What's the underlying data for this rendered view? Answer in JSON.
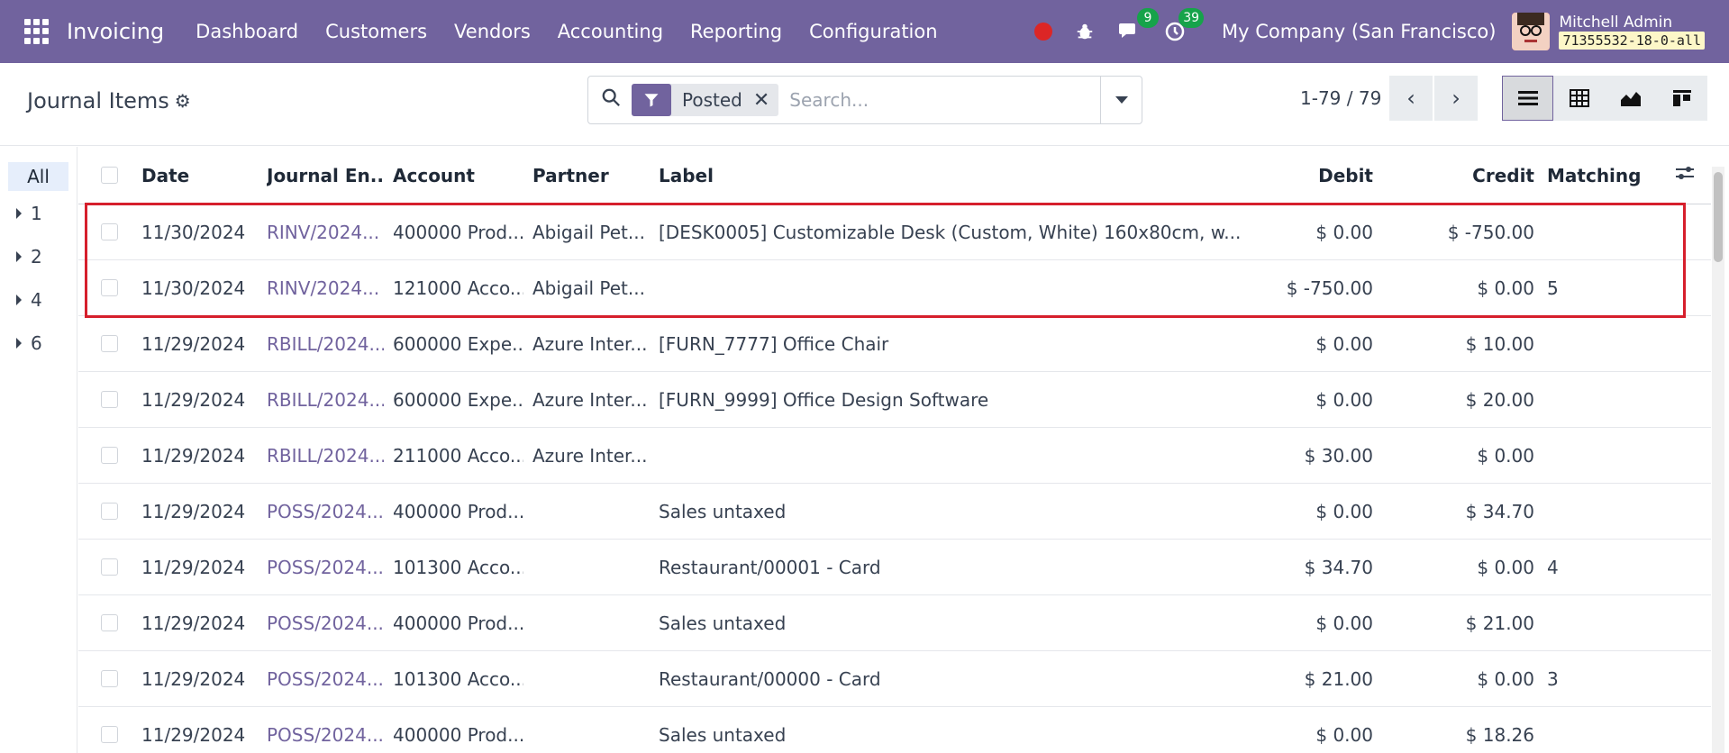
{
  "nav": {
    "brand": "Invoicing",
    "menu": [
      "Dashboard",
      "Customers",
      "Vendors",
      "Accounting",
      "Reporting",
      "Configuration"
    ],
    "messages_count": "9",
    "activities_count": "39",
    "company": "My Company (San Francisco)",
    "user_name": "Mitchell Admin",
    "db_label": "71355532-18-0-all"
  },
  "control": {
    "title": "Journal Items",
    "facet_label": "Posted",
    "search_placeholder": "Search...",
    "pager": "1-79 / 79"
  },
  "side": {
    "all_label": "All",
    "groups": [
      "1",
      "2",
      "4",
      "6"
    ]
  },
  "table": {
    "headers": {
      "date": "Date",
      "journal_entry": "Journal En...",
      "account": "Account",
      "partner": "Partner",
      "label": "Label",
      "debit": "Debit",
      "credit": "Credit",
      "matching": "Matching"
    },
    "rows": [
      {
        "date": "11/30/2024",
        "je": "RINV/2024...",
        "account": "400000 Prod...",
        "partner": "Abigail Pet...",
        "label": "[DESK0005] Customizable Desk (Custom, White) 160x80cm, w...",
        "debit": "$ 0.00",
        "credit": "$ -750.00",
        "matching": ""
      },
      {
        "date": "11/30/2024",
        "je": "RINV/2024...",
        "account": "121000 Acco...",
        "partner": "Abigail Pet...",
        "label": "",
        "debit": "$ -750.00",
        "credit": "$ 0.00",
        "matching": "5"
      },
      {
        "date": "11/29/2024",
        "je": "RBILL/2024...",
        "account": "600000 Expe...",
        "partner": "Azure Inter...",
        "label": "[FURN_7777] Office Chair",
        "debit": "$ 0.00",
        "credit": "$ 10.00",
        "matching": ""
      },
      {
        "date": "11/29/2024",
        "je": "RBILL/2024...",
        "account": "600000 Expe...",
        "partner": "Azure Inter...",
        "label": "[FURN_9999] Office Design Software",
        "debit": "$ 0.00",
        "credit": "$ 20.00",
        "matching": ""
      },
      {
        "date": "11/29/2024",
        "je": "RBILL/2024...",
        "account": "211000 Acco...",
        "partner": "Azure Inter...",
        "label": "",
        "debit": "$ 30.00",
        "credit": "$ 0.00",
        "matching": ""
      },
      {
        "date": "11/29/2024",
        "je": "POSS/2024...",
        "account": "400000 Prod...",
        "partner": "",
        "label": "Sales untaxed",
        "debit": "$ 0.00",
        "credit": "$ 34.70",
        "matching": ""
      },
      {
        "date": "11/29/2024",
        "je": "POSS/2024...",
        "account": "101300 Acco...",
        "partner": "",
        "label": "Restaurant/00001 - Card",
        "debit": "$ 34.70",
        "credit": "$ 0.00",
        "matching": "4"
      },
      {
        "date": "11/29/2024",
        "je": "POSS/2024...",
        "account": "400000 Prod...",
        "partner": "",
        "label": "Sales untaxed",
        "debit": "$ 0.00",
        "credit": "$ 21.00",
        "matching": ""
      },
      {
        "date": "11/29/2024",
        "je": "POSS/2024...",
        "account": "101300 Acco...",
        "partner": "",
        "label": "Restaurant/00000 - Card",
        "debit": "$ 21.00",
        "credit": "$ 0.00",
        "matching": "3"
      },
      {
        "date": "11/29/2024",
        "je": "POSS/2024...",
        "account": "400000 Prod...",
        "partner": "",
        "label": "Sales untaxed",
        "debit": "$ 0.00",
        "credit": "$ 18.26",
        "matching": ""
      }
    ]
  },
  "colors": {
    "brand": "#71639e",
    "badge": "#16a34a",
    "highlight": "#d61f2c"
  }
}
